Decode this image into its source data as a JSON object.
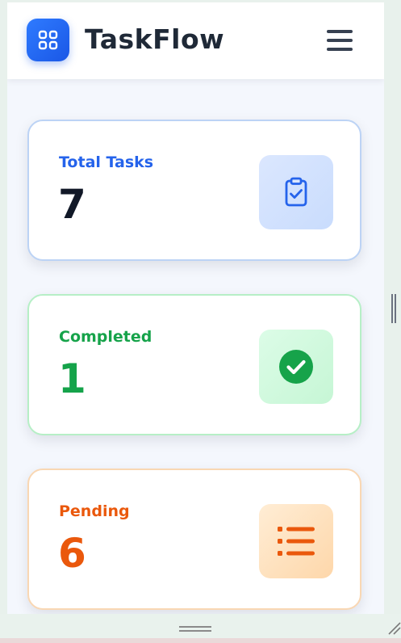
{
  "header": {
    "app_title": "TaskFlow",
    "logo_icon": "grid-icon",
    "menu_icon": "hamburger-menu-icon"
  },
  "stats": {
    "total": {
      "label": "Total Tasks",
      "value": "7",
      "icon": "clipboard-check-icon",
      "accent": "#2563eb"
    },
    "completed": {
      "label": "Completed",
      "value": "1",
      "icon": "check-circle-icon",
      "accent": "#16a34a"
    },
    "pending": {
      "label": "Pending",
      "value": "6",
      "icon": "list-icon",
      "accent": "#ea580c"
    }
  },
  "colors": {
    "brand": "#2563eb",
    "background": "#f4f7fd"
  }
}
